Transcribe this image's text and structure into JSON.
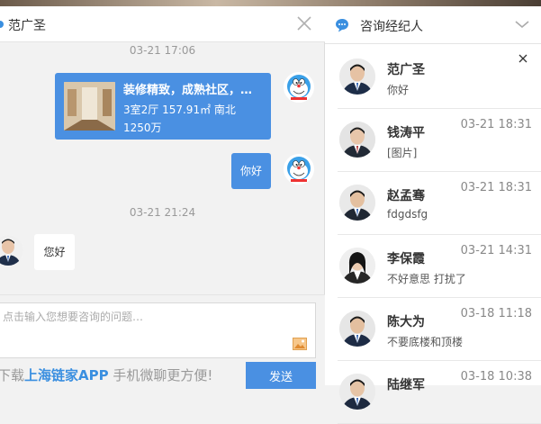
{
  "chat": {
    "agent_name": "范广圣",
    "messages": [
      {
        "type": "time",
        "text": "03-21 17:06"
      },
      {
        "type": "listing",
        "title": "装修精致，成熟社区，…",
        "spec": "3室2厅  157.91㎡  南北",
        "price": "1250万"
      },
      {
        "type": "text",
        "from": "me",
        "text": "你好"
      },
      {
        "type": "time",
        "text": "03-21 21:24"
      },
      {
        "type": "text",
        "from": "agent",
        "text": "您好"
      }
    ],
    "input_placeholder": "点击输入您想要咨询的问题…",
    "promo_prefix": "下载",
    "promo_app": "上海链家APP",
    "promo_suffix": "  手机微聊更方便!",
    "send_label": "发送"
  },
  "agents": {
    "title": "咨询经纪人",
    "list": [
      {
        "name": "范广圣",
        "message": "你好",
        "time": ""
      },
      {
        "name": "钱涛平",
        "message": "[图片]",
        "time": "03-21 18:31"
      },
      {
        "name": "赵孟骞",
        "message": "fdgdsfg",
        "time": "03-21 18:31"
      },
      {
        "name": "李保霞",
        "message": "不好意思 打扰了",
        "time": "03-21 14:31"
      },
      {
        "name": "陈大为",
        "message": "不要底楼和顶楼",
        "time": "03-18 11:18"
      },
      {
        "name": "陆继军",
        "message": "",
        "time": "03-18 10:38"
      }
    ]
  },
  "colors": {
    "accent": "#4a90e2",
    "brand_blue": "#3a8fe0"
  }
}
